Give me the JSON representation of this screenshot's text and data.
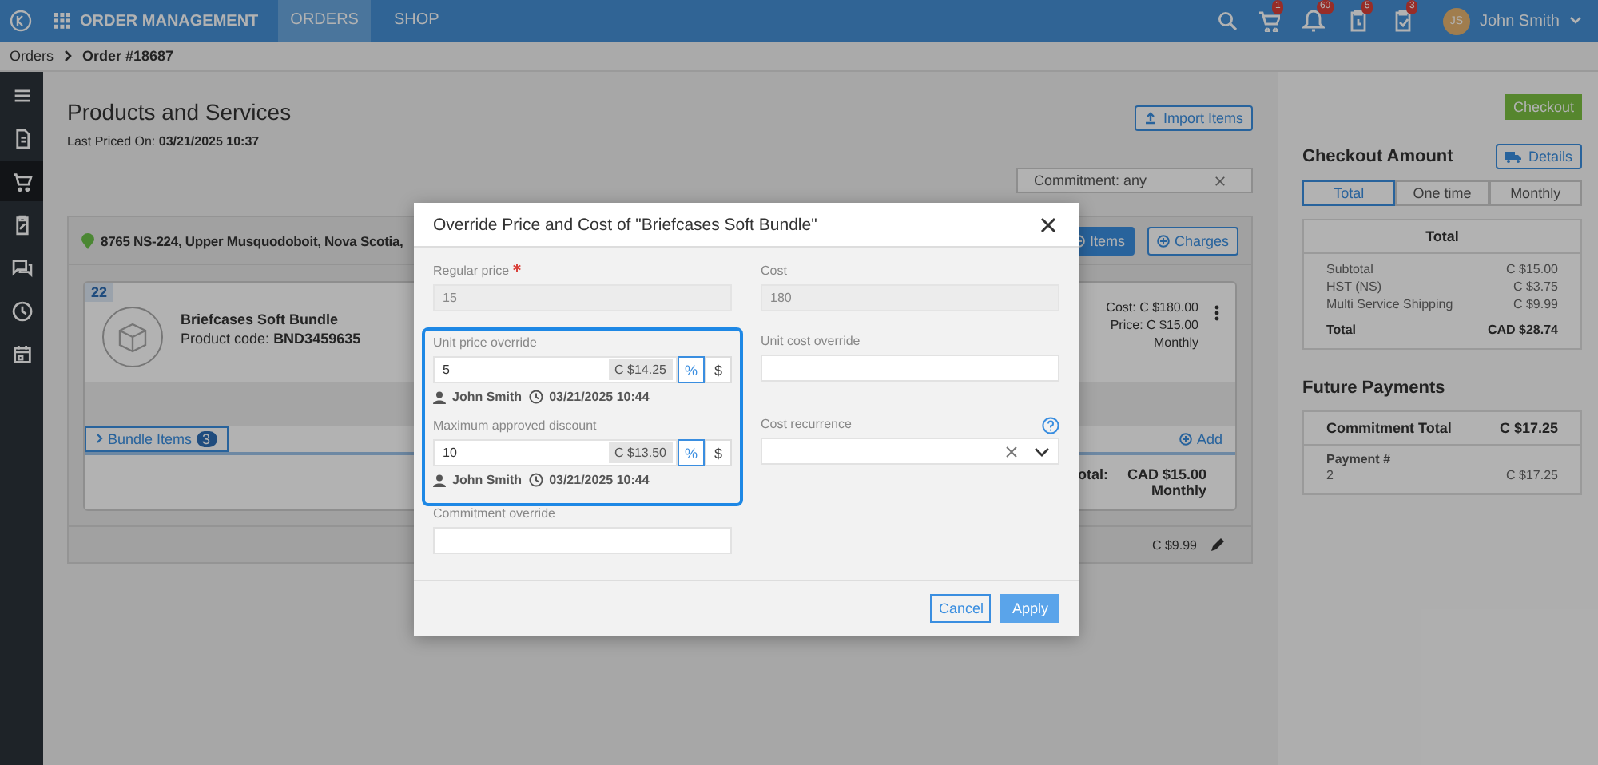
{
  "header": {
    "app_title": "ORDER MANAGEMENT",
    "nav": [
      {
        "label": "ORDERS",
        "selected": true
      },
      {
        "label": "SHOP",
        "selected": false
      }
    ],
    "badges": [
      {
        "count": "1"
      },
      {
        "count": "60"
      },
      {
        "count": "5"
      },
      {
        "count": "3"
      }
    ],
    "user": {
      "initials": "JS",
      "name": "John Smith"
    }
  },
  "breadcrumb": [
    "Orders",
    "Order #18687"
  ],
  "sidebar": {
    "items": [
      {
        "selected": false
      },
      {
        "selected": false
      },
      {
        "selected": true
      },
      {
        "selected": false
      },
      {
        "selected": false
      },
      {
        "selected": false
      },
      {
        "selected": false
      }
    ]
  },
  "main": {
    "title": "Products and Services",
    "last_priced_label": "Last Priced On:",
    "last_priced": "03/21/2025 10:37",
    "import_button": "Import Items",
    "filter": "Commitment: any",
    "location": "8765 NS-224, Upper Musquodoboit, Nova Scotia,",
    "add_buttons": [
      {
        "label": "Items",
        "kind": "filled"
      },
      {
        "label": "Charges",
        "kind": "outline"
      }
    ],
    "product": {
      "qty": "22",
      "name": "Briefcases Soft Bundle",
      "code_label": "Product code:",
      "code": "BND3459635",
      "cost_label": "Cost:",
      "cost": "C $180.00",
      "price_label": "Price:",
      "price": "C $15.00",
      "recurrence": "Monthly",
      "bundle_label": "Bundle Items",
      "bundle_count": "3",
      "add": "Add",
      "total_label": "otal:",
      "total": "CAD $15.00",
      "total_recurrence": "Monthly"
    },
    "shipping_price": "C $9.99"
  },
  "checkout": {
    "button": "Checkout",
    "title": "Checkout Amount",
    "details": "Details",
    "tabs": [
      {
        "label": "Total",
        "selected": true
      },
      {
        "label": "One time",
        "selected": false
      },
      {
        "label": "Monthly",
        "selected": false
      }
    ],
    "summary_title": "Total",
    "rows": [
      {
        "label": "Subtotal",
        "value": "C $15.00",
        "kind": "line"
      },
      {
        "label": "HST (NS)",
        "value": "C $3.75",
        "kind": "line"
      },
      {
        "label": "Multi Service Shipping",
        "value": "C $9.99",
        "kind": "line"
      },
      {
        "label": "Total",
        "value": "CAD $28.74",
        "kind": "total"
      }
    ],
    "future_title": "Future Payments",
    "commitment_label": "Commitment Total",
    "commitment_value": "C $17.25",
    "payment_label": "Payment #",
    "payments": [
      {
        "number": "2",
        "value": "C $17.25"
      }
    ]
  },
  "modal": {
    "title": "Override Price and Cost of \"Briefcases Soft Bundle\"",
    "left": [
      {
        "kind": "readonly",
        "label": "Regular price",
        "required": true,
        "value": "15"
      },
      {
        "kind": "override",
        "label": "Unit price override",
        "value": "5",
        "computed": "C $14.25",
        "units": [
          {
            "label": "%",
            "selected": true
          },
          {
            "label": "$",
            "selected": false
          }
        ],
        "author": "John Smith",
        "time": "03/21/2025 10:44"
      },
      {
        "kind": "override",
        "label": "Maximum approved discount",
        "value": "10",
        "computed": "C $13.50",
        "units": [
          {
            "label": "%",
            "selected": true
          },
          {
            "label": "$",
            "selected": false
          }
        ],
        "author": "John Smith",
        "time": "03/21/2025 10:44"
      },
      {
        "kind": "text",
        "label": "Commitment override"
      }
    ],
    "right": [
      {
        "kind": "readonly",
        "label": "Cost",
        "value": "180"
      },
      {
        "kind": "text",
        "label": "Unit cost override"
      },
      {
        "kind": "select",
        "label": "Cost recurrence",
        "help": true
      }
    ],
    "cancel": "Cancel",
    "apply": "Apply"
  }
}
